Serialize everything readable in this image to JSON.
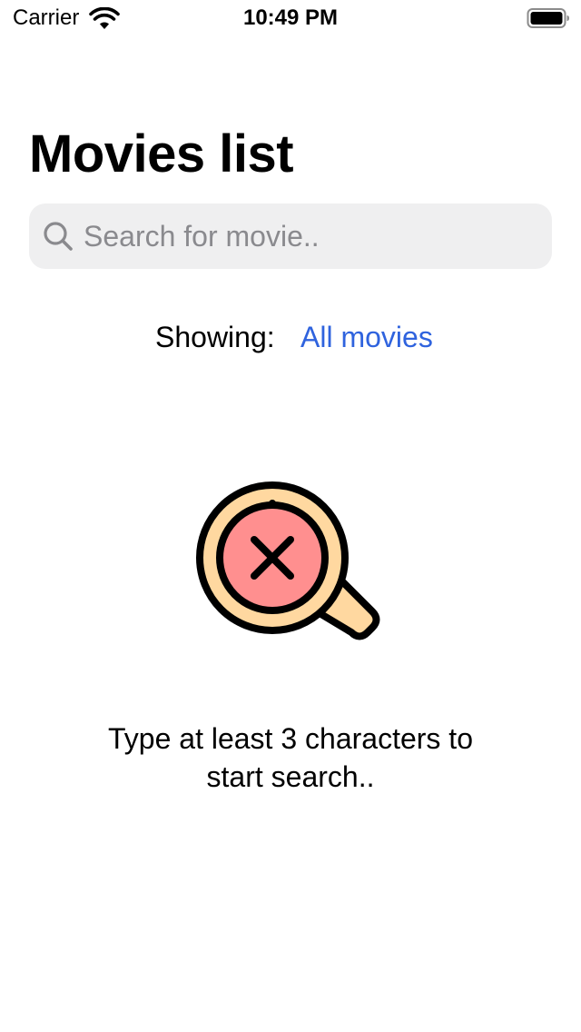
{
  "status_bar": {
    "carrier": "Carrier",
    "time": "10:49 PM"
  },
  "page": {
    "title": "Movies list"
  },
  "search": {
    "placeholder": "Search for movie..",
    "value": ""
  },
  "filter": {
    "label": "Showing:",
    "value": "All movies"
  },
  "empty_state": {
    "icon": "magnifier-x-icon",
    "message_line1": "Type at least 3 characters to",
    "message_line2": "start search.."
  },
  "colors": {
    "accent": "#2f63de",
    "search_background": "#efeff0",
    "placeholder": "#8a8a8e",
    "illustration_lens": "#ff8f8f",
    "illustration_ring": "#ffd8a0"
  }
}
